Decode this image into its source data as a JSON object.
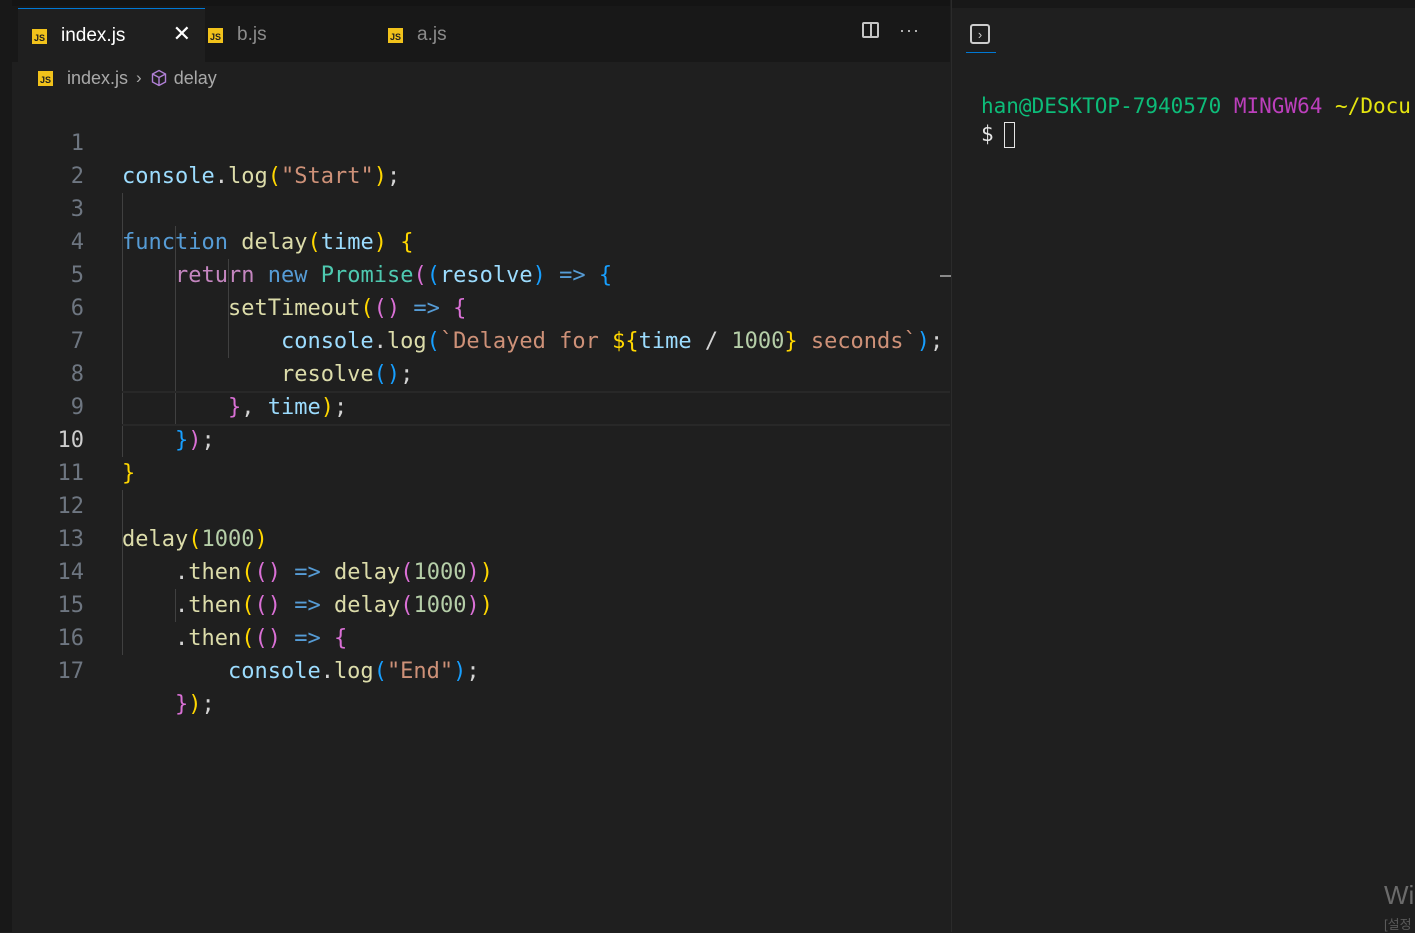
{
  "tabs": [
    {
      "label": "index.js",
      "icon": "JS",
      "active": true
    },
    {
      "label": "b.js",
      "icon": "JS",
      "active": false
    },
    {
      "label": "a.js",
      "icon": "JS",
      "active": false
    }
  ],
  "tab_close_glyph": "✕",
  "tab_actions": {
    "split_icon": "split-editor-icon",
    "more_glyph": "···"
  },
  "breadcrumb": {
    "file": "index.js",
    "symbol": "delay",
    "separator": "›"
  },
  "current_line": 10,
  "line_numbers": [
    "1",
    "2",
    "3",
    "4",
    "5",
    "6",
    "7",
    "8",
    "9",
    "10",
    "11",
    "12",
    "13",
    "14",
    "15",
    "16",
    "17"
  ],
  "code_lines": [
    "console.log(\"Start\");",
    "",
    "function delay(time) {",
    "    return new Promise((resolve) => {",
    "        setTimeout(() => {",
    "            console.log(`Delayed for ${time / 1000} seconds`);",
    "            resolve();",
    "        }, time);",
    "    });",
    "}",
    "",
    "delay(1000)",
    "    .then(() => delay(1000))",
    "    .then(() => delay(1000))",
    "    .then(() => {",
    "        console.log(\"End\");",
    "    });"
  ],
  "terminal": {
    "user": "han@DESKTOP-7940570",
    "system": "MINGW64",
    "path": "~/Docu",
    "prompt": "$",
    "tab_icon": "terminal-icon"
  },
  "watermark": {
    "text": "Wi",
    "sub": "[설정"
  },
  "colors": {
    "background": "#1f1f1f",
    "tab_accent": "#0078d4",
    "js_icon": "#f1c21b",
    "keyword": "#569cd6",
    "string": "#ce9178",
    "function": "#dcdcaa",
    "variable": "#9cdcfe"
  }
}
